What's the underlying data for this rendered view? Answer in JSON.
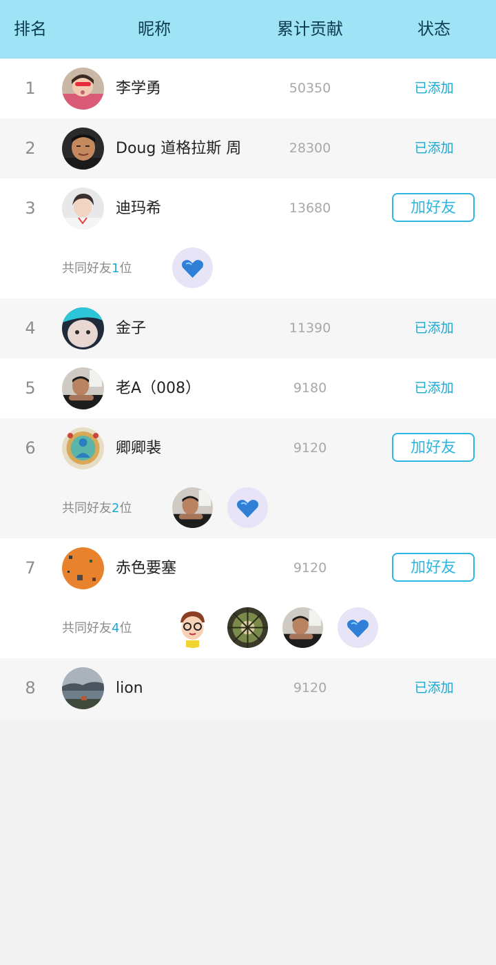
{
  "header": {
    "rank_label": "排名",
    "nickname_label": "昵称",
    "contribution_label": "累计贡献",
    "status_label": "状态"
  },
  "colors": {
    "header_bg": "#9ee4f6",
    "accent": "#17a9d6",
    "page_bg": "#f3f3f3"
  },
  "rows": [
    {
      "rank": "1",
      "name": "李学勇",
      "score": "50350",
      "status": "已添加",
      "avatar": "girl-photo-avatar"
    },
    {
      "rank": "2",
      "name": "Doug 道格拉斯 周",
      "score": "28300",
      "status": "已添加",
      "avatar": "man-photo-avatar"
    },
    {
      "rank": "3",
      "name": "迪玛希",
      "score": "13680",
      "status": "加好友",
      "avatar": "singer-photo-avatar",
      "mutual": {
        "prefix": "共同好友",
        "count": "1",
        "suffix": "位",
        "avatars": [
          "blue-heart-avatar"
        ]
      }
    },
    {
      "rank": "4",
      "name": "金子",
      "score": "11390",
      "status": "已添加",
      "avatar": "doll-avatar"
    },
    {
      "rank": "5",
      "name": "老A（008）",
      "score": "9180",
      "status": "已添加",
      "avatar": "man-office-avatar"
    },
    {
      "rank": "6",
      "name": "卿卿裴",
      "score": "9120",
      "status": "加好友",
      "avatar": "thangka-avatar",
      "mutual": {
        "prefix": "共同好友",
        "count": "2",
        "suffix": "位",
        "avatars": [
          "man-office-avatar",
          "blue-heart-avatar"
        ]
      }
    },
    {
      "rank": "7",
      "name": "赤色要塞",
      "score": "9120",
      "status": "加好友",
      "avatar": "orange-game-avatar",
      "mutual": {
        "prefix": "共同好友",
        "count": "4",
        "suffix": "位",
        "avatars": [
          "cartoon-boy-avatar",
          "tree-avatar",
          "man-office-avatar",
          "blue-heart-avatar"
        ]
      }
    },
    {
      "rank": "8",
      "name": "lion",
      "score": "9120",
      "status": "已添加",
      "avatar": "lake-landscape-avatar"
    }
  ]
}
